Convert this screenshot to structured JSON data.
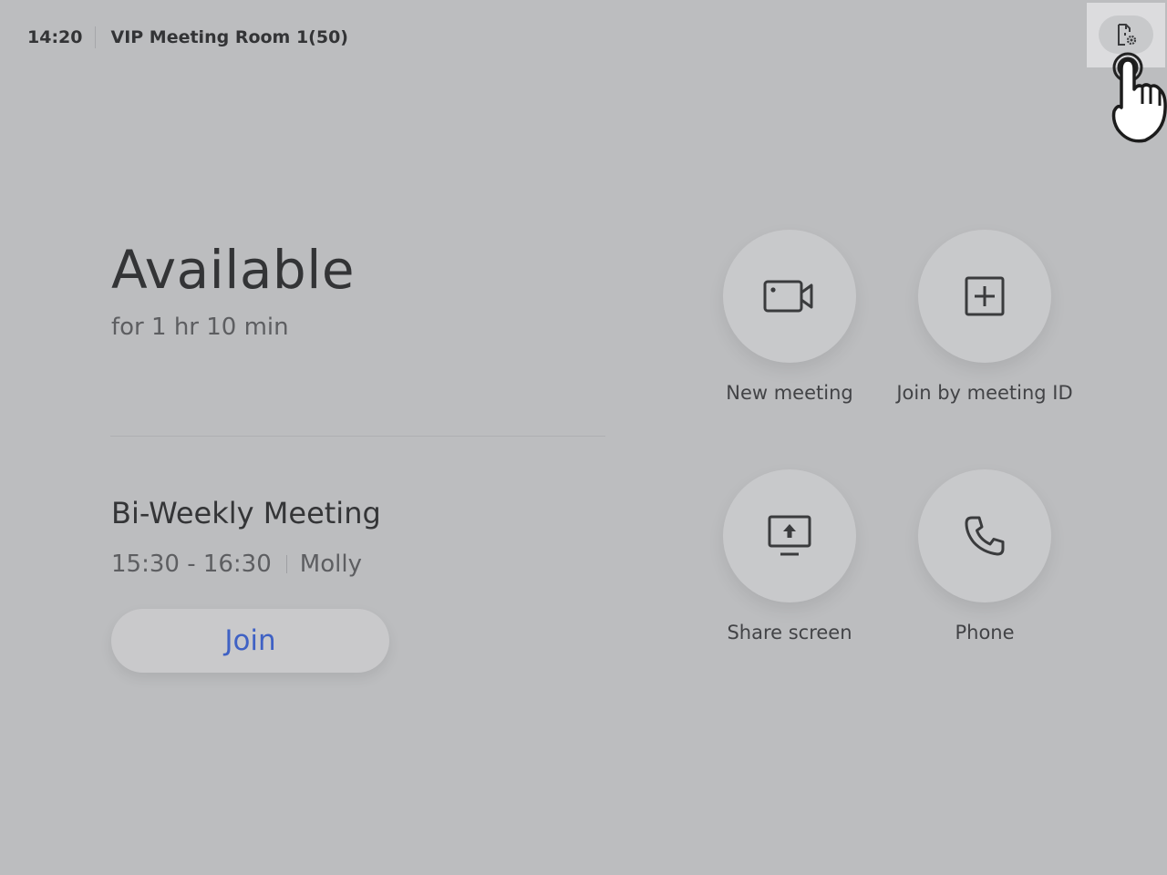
{
  "header": {
    "time": "14:20",
    "room_name": "VIP Meeting Room 1(50)"
  },
  "status": {
    "title": "Available",
    "subtitle": "for 1 hr 10 min"
  },
  "meeting": {
    "title": "Bi-Weekly Meeting",
    "time_range": "15:30 - 16:30",
    "host": "Molly",
    "join_label": "Join"
  },
  "actions": [
    {
      "label": "New meeting",
      "icon": "video-camera-icon"
    },
    {
      "label": "Join by meeting ID",
      "icon": "plus-square-icon"
    },
    {
      "label": "Share screen",
      "icon": "share-screen-icon"
    },
    {
      "label": "Phone",
      "icon": "phone-icon"
    }
  ],
  "colors": {
    "background": "#bcbdbf",
    "accent": "#3f61c4",
    "button": "#c8c9cb"
  }
}
